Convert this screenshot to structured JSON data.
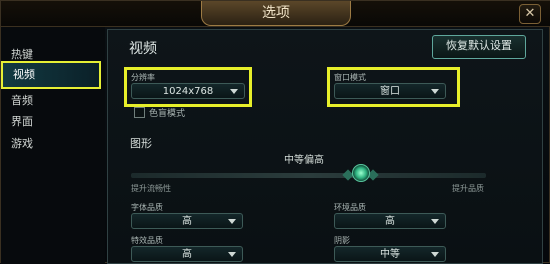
{
  "window": {
    "title": "选项",
    "close_symbol": "✕"
  },
  "sidebar": {
    "items": [
      {
        "label": "热键"
      },
      {
        "label": "视频"
      },
      {
        "label": "音频"
      },
      {
        "label": "界面"
      },
      {
        "label": "游戏"
      }
    ],
    "active_index": 1
  },
  "section": {
    "title": "视频",
    "reset_label": "恢复默认设置"
  },
  "resolution": {
    "label": "分辨率",
    "value": "1024x768"
  },
  "window_mode": {
    "label": "窗口模式",
    "value": "窗口"
  },
  "colorblind": {
    "label": "色盲模式",
    "checked": false
  },
  "graphics": {
    "title": "图形",
    "quality_value": "中等偏高",
    "slider_left_label": "提升流畅性",
    "slider_right_label": "提升品质"
  },
  "settings": {
    "char_quality": {
      "label": "字体品质",
      "value": "高"
    },
    "env_quality": {
      "label": "环境品质",
      "value": "高"
    },
    "effects_quality": {
      "label": "特效品质",
      "value": "高"
    },
    "shadow": {
      "label": "阴影",
      "value": "中等"
    }
  },
  "colors": {
    "highlight": "#e7ef2a",
    "accent": "#5fa79c",
    "title_gold": "#9d7b44"
  }
}
